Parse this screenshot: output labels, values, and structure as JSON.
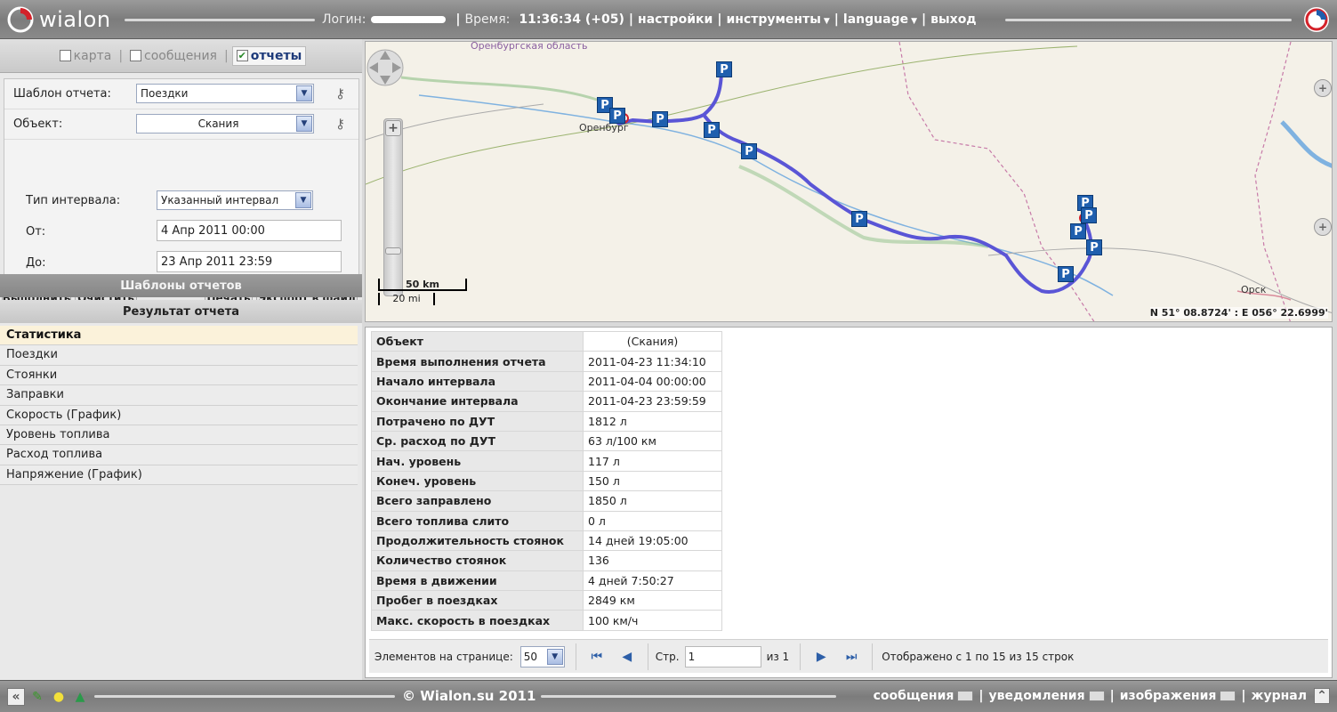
{
  "app": {
    "logo_text": "wialon",
    "login_label": "Логин:",
    "time_label": "Время:",
    "time_value": "11:36:34 (+05)",
    "menu": [
      "настройки",
      "инструменты",
      "language",
      "выход"
    ]
  },
  "view_switch": {
    "items": [
      {
        "label": "карта",
        "checked": false
      },
      {
        "label": "сообщения",
        "checked": false
      },
      {
        "label": "отчеты",
        "checked": true
      }
    ]
  },
  "form": {
    "template_label": "Шаблон отчета:",
    "template_value": "Поездки",
    "object_label": "Объект:",
    "object_value": "Скания",
    "interval_type_label": "Тип интервала:",
    "interval_type_value": "Указанный интервал",
    "from_label": "От:",
    "from_value": "4 Апр 2011 00:00",
    "to_label": "До:",
    "to_value": "23 Апр 2011 23:59"
  },
  "actions": {
    "execute": "Выполнить",
    "clear": "Очистить",
    "print": "Печать",
    "export": "Экспорт в файл"
  },
  "sections": {
    "templates": "Шаблоны отчетов",
    "result": "Результат отчета"
  },
  "result_items": [
    "Статистика",
    "Поездки",
    "Стоянки",
    "Заправки",
    "Скорость (График)",
    "Уровень топлива",
    "Расход топлива",
    "Напряжение (График)"
  ],
  "map": {
    "region_label": "Оренбургская область",
    "city1": "Оренбург",
    "city2": "Орск",
    "scale_km": "50 km",
    "scale_mi": "20 mi",
    "coords": "N 51° 08.8724' : E 056° 22.6999'"
  },
  "stats": [
    {
      "k": "Объект",
      "v": "(Скания)"
    },
    {
      "k": "Время выполнения отчета",
      "v": "2011-04-23 11:34:10"
    },
    {
      "k": "Начало интервала",
      "v": "2011-04-04 00:00:00"
    },
    {
      "k": "Окончание интервала",
      "v": "2011-04-23 23:59:59"
    },
    {
      "k": "Потрачено по ДУТ",
      "v": "1812 л"
    },
    {
      "k": "Ср. расход по ДУТ",
      "v": "63 л/100 км"
    },
    {
      "k": "Нач. уровень",
      "v": "117 л"
    },
    {
      "k": "Конеч. уровень",
      "v": "150 л"
    },
    {
      "k": "Всего заправлено",
      "v": "1850 л"
    },
    {
      "k": "Всего топлива слито",
      "v": "0 л"
    },
    {
      "k": "Продолжительность стоянок",
      "v": "14 дней 19:05:00"
    },
    {
      "k": "Количество стоянок",
      "v": "136"
    },
    {
      "k": "Время в движении",
      "v": "4 дней 7:50:27"
    },
    {
      "k": "Пробег в поездках",
      "v": "2849 км"
    },
    {
      "k": "Макс. скорость в поездках",
      "v": "100 км/ч"
    }
  ],
  "pager": {
    "per_page_label": "Элементов на странице:",
    "per_page_value": "50",
    "page_label": "Стр.",
    "page_value": "1",
    "of_label": "из 1",
    "info": "Отображено с 1 по 15 из 15 строк"
  },
  "footer": {
    "copyright": "© Wialon.su 2011",
    "links": [
      "сообщения",
      "уведомления",
      "изображения",
      "журнал"
    ]
  },
  "colors": {
    "track": "#5a55d6",
    "parking": "#1f5fae",
    "selected_row": "#fbf2da"
  }
}
